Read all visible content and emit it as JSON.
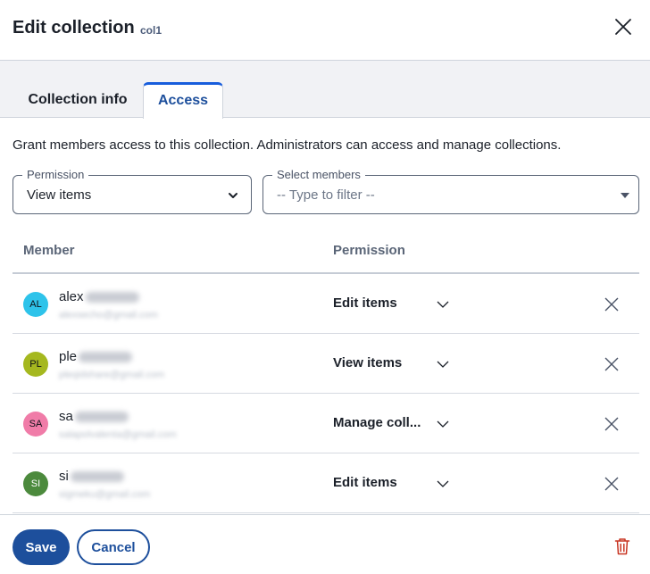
{
  "dialog": {
    "title": "Edit collection",
    "collection_name": "col1"
  },
  "tabs": [
    {
      "label": "Collection info",
      "active": false
    },
    {
      "label": "Access",
      "active": true
    }
  ],
  "access": {
    "description": "Grant members access to this collection. Administrators can access and manage collections.",
    "permission_field": {
      "label": "Permission",
      "value": "View items"
    },
    "members_field": {
      "label": "Select members",
      "placeholder": "-- Type to filter --"
    }
  },
  "table": {
    "headers": {
      "member": "Member",
      "permission": "Permission"
    },
    "rows": [
      {
        "initials": "AL",
        "name": "alex",
        "email": "alexsecho@gmail.com",
        "permission": "Edit items",
        "avatar_color": "#2ec3ea"
      },
      {
        "initials": "PL",
        "name": "ple",
        "email": "pleqidshare@gmail.com",
        "permission": "View items",
        "avatar_color": "#a5b81f"
      },
      {
        "initials": "SA",
        "name": "sa",
        "email": "salapolvalenta@gmail.com",
        "permission": "Manage coll...",
        "avatar_color": "#f07ca8"
      },
      {
        "initials": "SI",
        "name": "si",
        "email": "sigmeku@gmail.com",
        "permission": "Edit items",
        "avatar_color": "#4c8a3d"
      }
    ]
  },
  "footer": {
    "save_label": "Save",
    "cancel_label": "Cancel"
  },
  "icons": {
    "close": "close-icon",
    "chevron": "chevron-down-icon",
    "remove": "x-icon",
    "delete": "trash-icon"
  },
  "colors": {
    "accent": "#1d4f9c",
    "danger": "#c83522"
  }
}
